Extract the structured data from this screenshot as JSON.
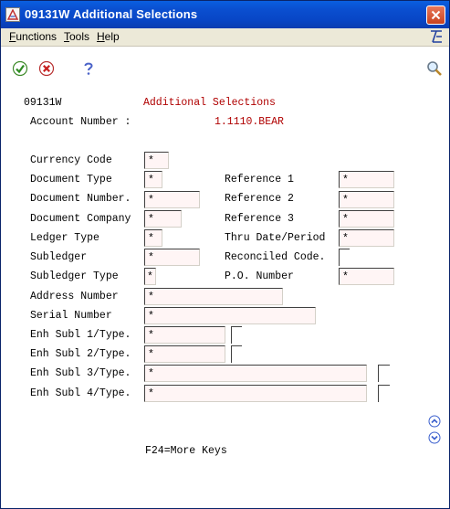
{
  "window": {
    "title": "09131W   Additional Selections"
  },
  "menu": {
    "functions": {
      "accel": "F",
      "rest": "unctions"
    },
    "tools": {
      "accel": "T",
      "rest": "ools"
    },
    "help": {
      "accel": "H",
      "rest": "elp"
    }
  },
  "form": {
    "form_id": "09131W",
    "form_title": "Additional Selections",
    "account_label": "Account Number :",
    "account_value": "1.1110.BEAR",
    "fields": {
      "currency_code": {
        "label": "Currency Code",
        "value": "*"
      },
      "document_type": {
        "label": "Document Type",
        "value": "*"
      },
      "document_number": {
        "label": "Document Number.",
        "value": "*"
      },
      "document_company": {
        "label": "Document Company",
        "value": "*"
      },
      "ledger_type": {
        "label": "Ledger Type",
        "value": "*"
      },
      "subledger": {
        "label": "Subledger",
        "value": "*"
      },
      "subledger_type": {
        "label": "Subledger Type",
        "value": "*"
      },
      "address_number": {
        "label": "Address Number",
        "value": "*"
      },
      "serial_number": {
        "label": "Serial Number",
        "value": "*"
      },
      "enh_subl_1": {
        "label": "Enh Subl 1/Type.",
        "value": "*",
        "type_value": ""
      },
      "enh_subl_2": {
        "label": "Enh Subl 2/Type.",
        "value": "*",
        "type_value": ""
      },
      "enh_subl_3": {
        "label": "Enh Subl 3/Type.",
        "value": "*",
        "type_value": ""
      },
      "enh_subl_4": {
        "label": "Enh Subl 4/Type.",
        "value": "*",
        "type_value": ""
      },
      "reference_1": {
        "label": "Reference 1",
        "value": "*"
      },
      "reference_2": {
        "label": "Reference 2",
        "value": "*"
      },
      "reference_3": {
        "label": "Reference 3",
        "value": "*"
      },
      "thru_date_period": {
        "label": "Thru Date/Period",
        "value": "*"
      },
      "reconciled_code": {
        "label": "Reconciled Code.",
        "value": ""
      },
      "po_number": {
        "label": "P.O. Number",
        "value": "*"
      }
    },
    "footer_keys": "F24=More Keys"
  },
  "colors": {
    "title_bar": "#0A4FD0",
    "accent_red": "#B00000"
  },
  "icons": {
    "app": "document-icon",
    "brand": "jde-logo-icon",
    "ok": "check-icon",
    "cancel": "cancel-icon",
    "help": "question-icon",
    "search": "magnifier-icon",
    "page_up": "chevron-up-circle-icon",
    "page_down": "chevron-down-circle-icon"
  }
}
